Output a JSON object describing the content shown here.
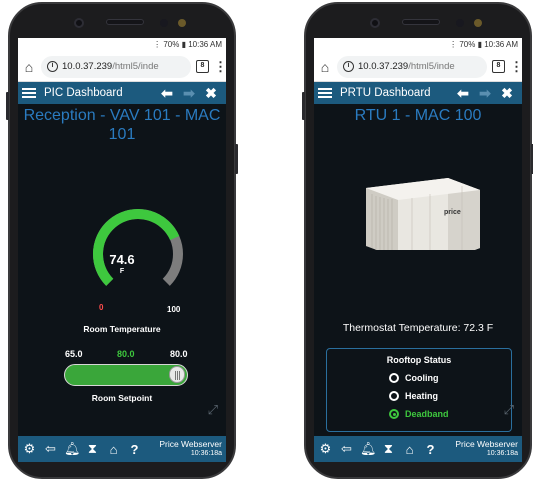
{
  "phones": [
    {
      "status": "⚙ᴸᵗᵉ 70% ▮ 10:36 AM",
      "status_text": "⋮ 70% ▮ 10:36 AM",
      "url_host": "10.0.37.239",
      "url_path": "/html5/inde",
      "tabs_count": "8",
      "app_title": "PIC Dashboard",
      "page_title": "Reception - VAV 101 - MAC 101",
      "gauge": {
        "value_display": "74.6",
        "unit": "F",
        "min_label": "0",
        "max_label": "100",
        "value": 74.6,
        "min": 0,
        "max": 100,
        "label": "Room Temperature"
      },
      "setpoint": {
        "min_label": "65.0",
        "current_label": "80.0",
        "max_label": "80.0",
        "label": "Room Setpoint",
        "fraction": 1.0
      },
      "server": "Price Webserver",
      "time": "10:36:18a"
    },
    {
      "status_text": "⋮ 70% ▮ 10:36 AM",
      "url_host": "10.0.37.239",
      "url_path": "/html5/inde",
      "tabs_count": "8",
      "app_title": "PRTU Dashboard",
      "page_title": "RTU 1 - MAC 100",
      "unit_brand": "price",
      "thermostat": "Thermostat Temperature: 72.3 F",
      "rooftop": {
        "title": "Rooftop Status",
        "options": [
          {
            "label": "Cooling",
            "selected": false
          },
          {
            "label": "Heating",
            "selected": false
          },
          {
            "label": "Deadband",
            "selected": true
          }
        ]
      },
      "server": "Price Webserver",
      "time": "10:36:18a"
    }
  ],
  "colors": {
    "appbar": "#1c5a7e",
    "title_blue": "#2a7bc0",
    "gauge_green": "#3ec83e",
    "gauge_gray": "#7d7d7d",
    "deadband_green": "#3ec83e"
  },
  "icons": [
    "home-icon",
    "info-icon",
    "tabs-icon",
    "menu-icon",
    "back-arrow-icon",
    "forward-arrow-icon",
    "close-icon",
    "gear-icon",
    "logout-icon",
    "bell-icon",
    "hourglass-icon",
    "home-icon",
    "help-icon",
    "expand-icon"
  ]
}
